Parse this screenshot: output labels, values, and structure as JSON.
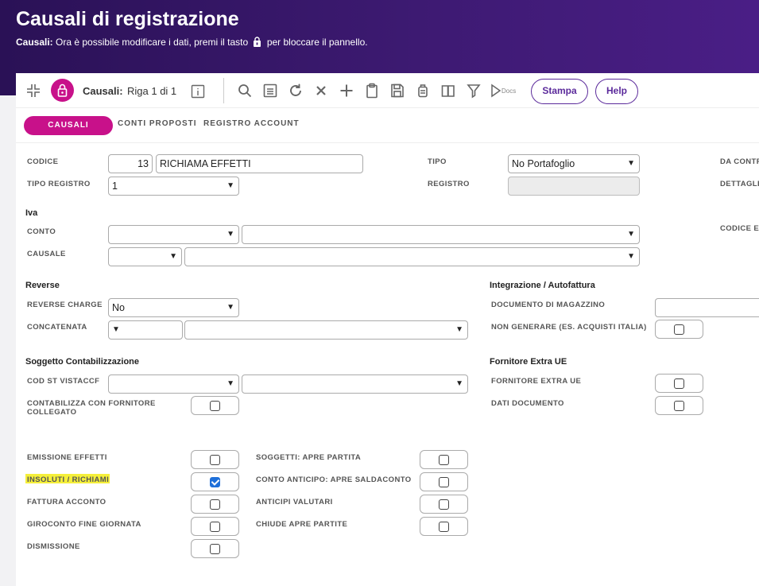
{
  "header": {
    "title": "Causali di registrazione",
    "subtitle_bold": "Causali:",
    "subtitle_pre": "Ora è possibile modificare i dati, premi il tasto",
    "subtitle_post": "per bloccare il pannello."
  },
  "toolbar": {
    "entity": "Causali:",
    "row_info": "Riga 1 di 1",
    "docs_label": "Docs",
    "stampa": "Stampa",
    "help": "Help"
  },
  "tabs": {
    "causali": "CAUSALI",
    "conti_proposti": "CONTI PROPOSTI",
    "registro_account": "REGISTRO ACCOUNT"
  },
  "form": {
    "codice_label": "CODICE",
    "codice_value": "13",
    "codice_desc": "RICHIAMA EFFETTI",
    "tipo_registro_label": "TIPO REGISTRO",
    "tipo_registro_value": "1",
    "tipo_label": "TIPO",
    "tipo_value": "No Portafoglio",
    "registro_label": "REGISTRO",
    "da_contr_label": "DA CONTR",
    "dettagli_label": "DETTAGLI",
    "codice_ex_label": "CODICE EX",
    "iva_section": "Iva",
    "conto_label": "CONTO",
    "causale_label": "CAUSALE",
    "reverse_section": "Reverse",
    "reverse_charge_label": "REVERSE CHARGE",
    "reverse_charge_value": "No",
    "concatenata_label": "CONCATENATA",
    "integrazione_section": "Integrazione / Autofattura",
    "documento_magazzino_label": "DOCUMENTO DI MAGAZZINO",
    "non_generare_label": "NON GENERARE (ES. ACQUISTI ITALIA)",
    "soggetto_section": "Soggetto Contabilizzazione",
    "cod_st_label": "COD ST VISTACCF",
    "contabilizza_label_1": "CONTABILIZZA CON FORNITORE",
    "contabilizza_label_2": "COLLEGATO",
    "fornitore_section": "Fornitore Extra UE",
    "fornitore_extra_label": "FORNITORE EXTRA UE",
    "dati_documento_label": "DATI DOCUMENTO",
    "emissione_effetti_label": "EMISSIONE EFFETTI",
    "insoluti_label": "INSOLUTI / RICHIAMI",
    "fattura_acconto_label": "FATTURA ACCONTO",
    "giroconto_label": "GIROCONTO FINE GIORNATA",
    "dismissione_label": "DISMISSIONE",
    "soggetti_apre_label": "SOGGETTI: APRE PARTITA",
    "conto_anticipo_label": "CONTO ANTICIPO: APRE SALDACONTO",
    "anticipi_valutari_label": "ANTICIPI VALUTARI",
    "chiude_apre_label": "CHIUDE APRE PARTITE",
    "insoluti_checked": true
  },
  "colors": {
    "header_bg": "#3d1a72",
    "accent": "#c8118a",
    "button_border": "#5b2a9b",
    "check": "#1e6fd9",
    "highlight": "#f5ef3a"
  },
  "icons": [
    "collapse-icon",
    "lock-icon",
    "info-icon",
    "search-icon",
    "list-icon",
    "refresh-icon",
    "delete-icon",
    "add-icon",
    "clipboard-icon",
    "save-icon",
    "bag-icon",
    "book-icon",
    "filter-icon",
    "docs-icon"
  ]
}
